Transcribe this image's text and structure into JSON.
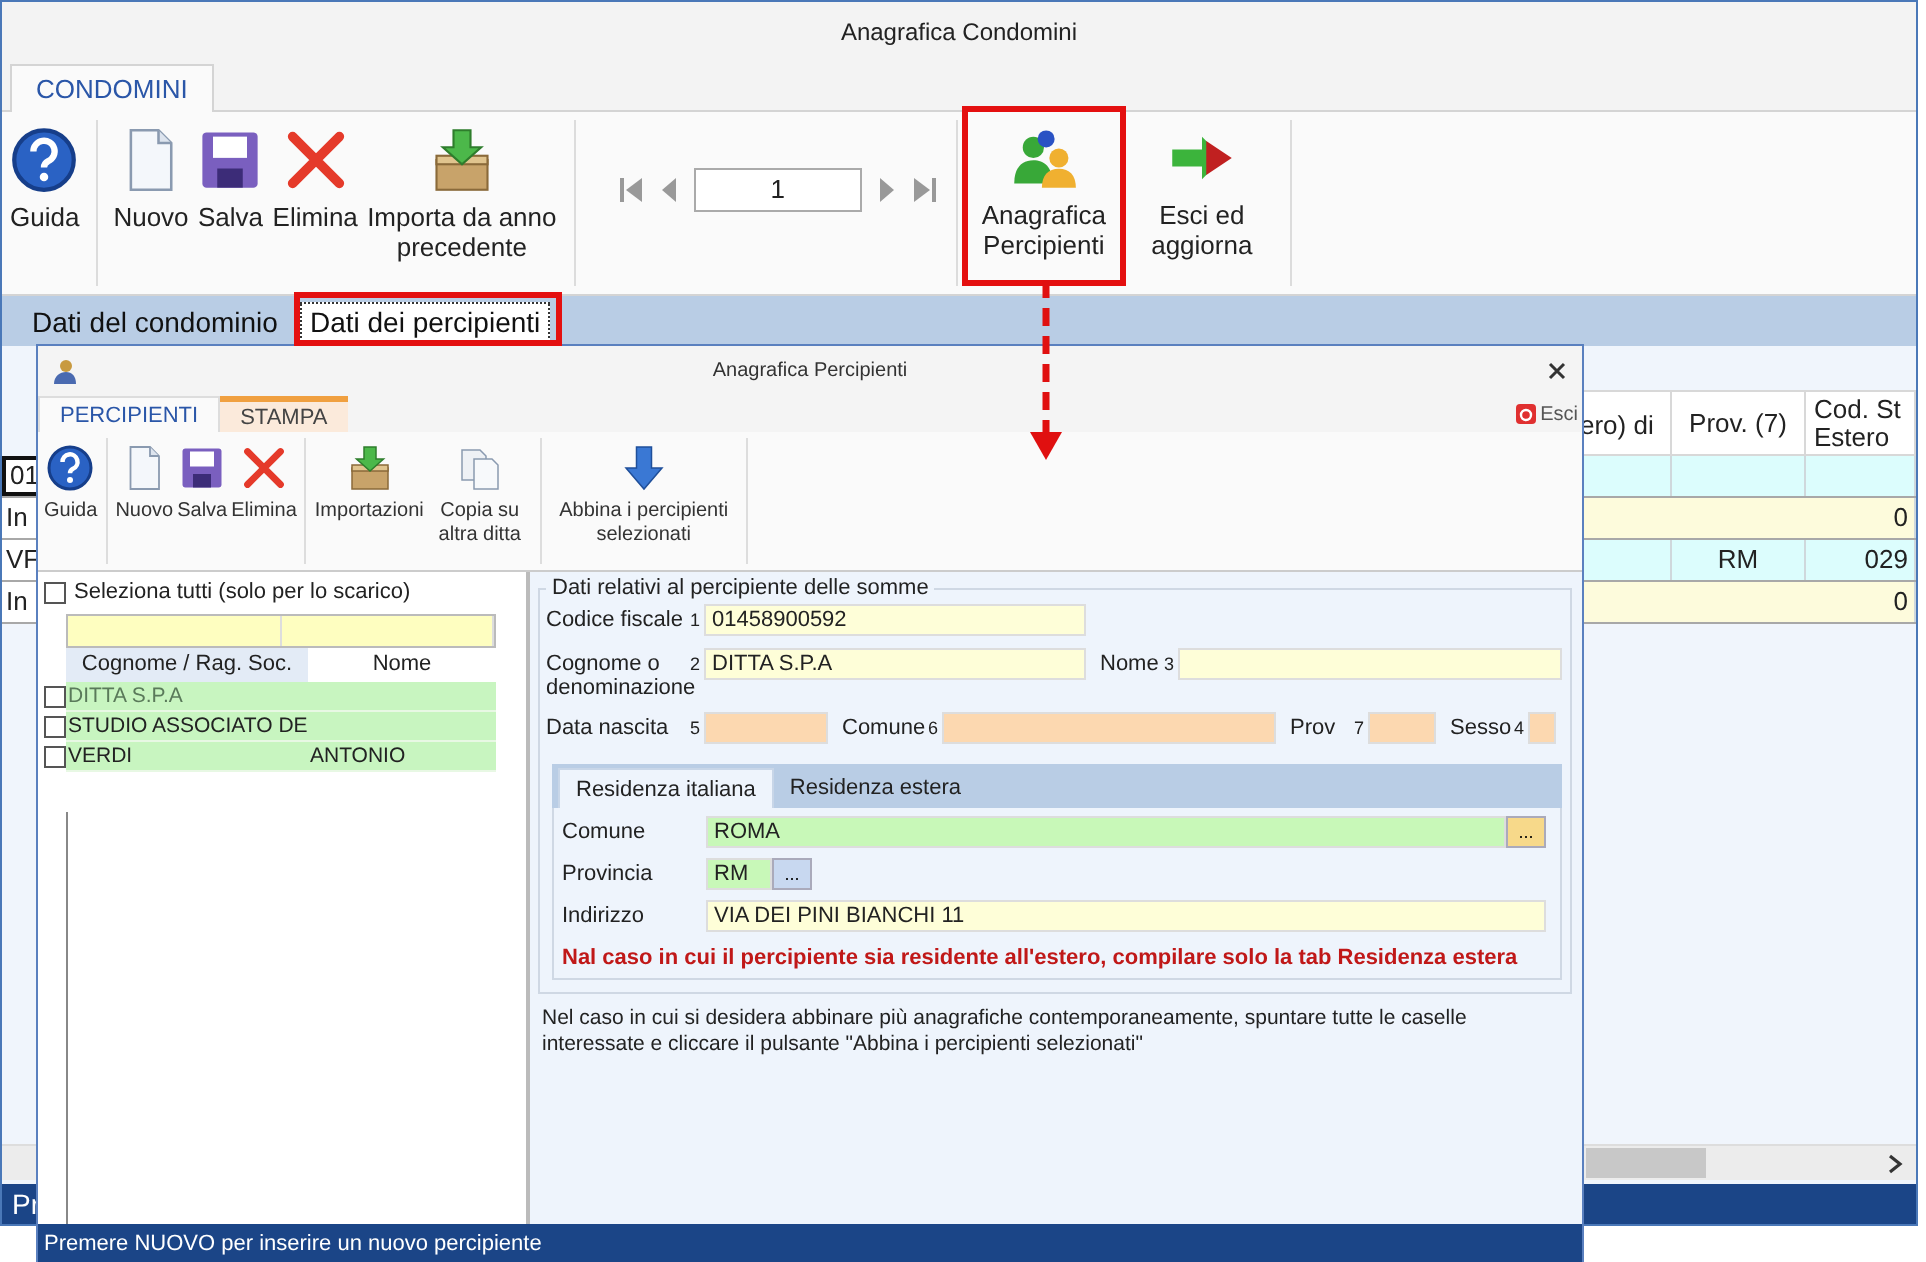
{
  "main_window": {
    "title": "Anagrafica Condomini",
    "tabs": [
      {
        "label": "CONDOMINI",
        "selected": true
      }
    ],
    "toolbar": [
      {
        "label": "Guida"
      },
      {
        "label": "Nuovo"
      },
      {
        "label": "Salva"
      },
      {
        "label": "Elimina"
      },
      {
        "label": "Importa da anno precedente"
      }
    ],
    "navigator": {
      "page": "1"
    },
    "toolbar_right": [
      {
        "label": "Anagrafica Percipienti"
      },
      {
        "label": "Esci ed aggiorna"
      }
    ],
    "sections": [
      {
        "label": "Dati del condominio",
        "selected": false
      },
      {
        "label": "Dati dei percipienti",
        "selected": true
      }
    ],
    "table": {
      "columns": [
        "ero) di",
        "Prov. (7)",
        "Cod. St\nEstero"
      ],
      "rows": [
        {
          "kind": "detail",
          "label": "01",
          "selected": true
        },
        {
          "kind": "total",
          "label": "In",
          "total": "0",
          "selected": false
        },
        {
          "kind": "detail",
          "label": "VF",
          "prov": "RM",
          "cod": "029",
          "selected": false
        },
        {
          "kind": "total",
          "label": "In",
          "total": "0",
          "selected": false
        }
      ]
    },
    "status_bar": "Pr"
  },
  "dialog": {
    "title": "Anagrafica Percipienti",
    "tabs": [
      {
        "label": "PERCIPIENTI",
        "selected": true
      },
      {
        "label": "STAMPA",
        "selected": false
      }
    ],
    "exit_label": "Esci",
    "toolbar": [
      {
        "label": "Guida"
      },
      {
        "label": "Nuovo"
      },
      {
        "label": "Salva"
      },
      {
        "label": "Elimina"
      },
      {
        "label": "Importazioni"
      },
      {
        "label": "Copia su altra ditta"
      },
      {
        "label": "Abbina i percipienti selezionati"
      }
    ],
    "select_all": {
      "label": "Seleziona tutti (solo per lo scarico)",
      "checked": false
    },
    "list": {
      "columns": [
        "Cognome / Rag. Soc.",
        "Nome"
      ],
      "rows": [
        {
          "name": "DITTA S.P.A",
          "selected": true,
          "checked": false
        },
        {
          "name": "STUDIO ASSOCIATO DE",
          "selected": false,
          "checked": false
        },
        {
          "name": "VERDI",
          "first_name": "ANTONIO",
          "selected": false,
          "checked": false
        }
      ]
    },
    "form": {
      "title": "Dati relativi al percipiente delle somme",
      "codice_fiscale": {
        "label": "Codice fiscale",
        "number": "1",
        "value": "01458900592"
      },
      "cognome": {
        "label": "Cognome o denominazione",
        "number": "2",
        "value": "DITTA S.P.A"
      },
      "nome": {
        "label": "Nome",
        "number": "3"
      },
      "data_nascita": {
        "label": "Data nascita",
        "number": "5"
      },
      "comune": {
        "label": "Comune",
        "number": "6"
      },
      "prov": {
        "label": "Prov",
        "number": "7"
      },
      "sesso": {
        "label": "Sesso",
        "number": "4"
      },
      "residence_tabs": [
        {
          "label": "Residenza italiana",
          "selected": true
        },
        {
          "label": "Residenza estera",
          "selected": false
        }
      ],
      "residence": {
        "comune": {
          "label": "Comune",
          "value": "ROMA",
          "button": "..."
        },
        "provincia": {
          "label": "Provincia",
          "value": "RM",
          "button": "..."
        },
        "indirizzo": {
          "label": "Indirizzo",
          "value": "VIA DEI PINI BIANCHI 11"
        },
        "warning": "Nal caso in cui il percipiente sia residente all'estero, compilare solo la tab Residenza estera"
      }
    },
    "note": "Nel caso in cui si desidera abbinare più anagrafiche contemporaneamente, spuntare tutte le caselle interessate e cliccare il pulsante \"Abbina i percipienti selezionati\"",
    "status_bar": "Premere NUOVO per inserire un nuovo percipiente"
  }
}
